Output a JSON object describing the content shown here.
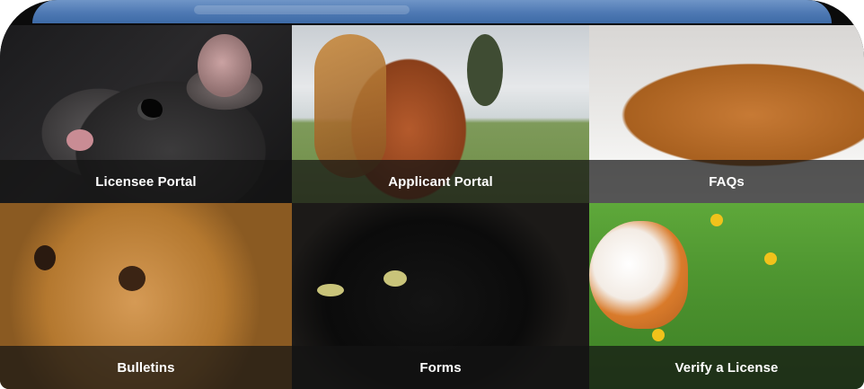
{
  "tiles": [
    {
      "label": "Licensee Portal",
      "image": "rat-photo"
    },
    {
      "label": "Applicant Portal",
      "image": "horse-photo"
    },
    {
      "label": "FAQs",
      "image": "orange-cat-photo"
    },
    {
      "label": "Bulletins",
      "image": "dog-photo"
    },
    {
      "label": "Forms",
      "image": "black-cat-photo"
    },
    {
      "label": "Verify a License",
      "image": "guinea-pig-photo"
    }
  ]
}
